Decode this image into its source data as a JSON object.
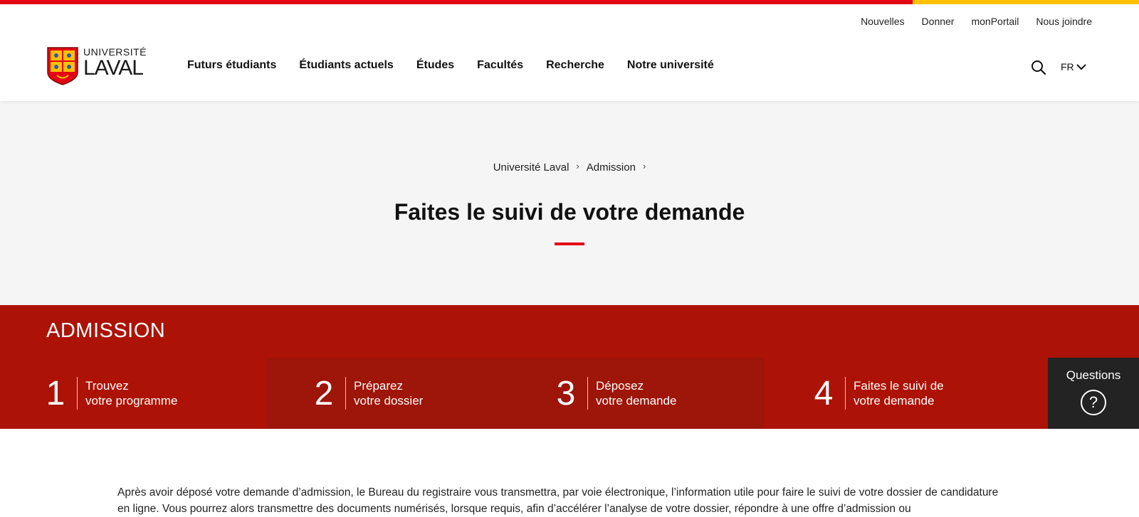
{
  "colors": {
    "brand_red": "#e30513",
    "brand_yellow": "#ffc103",
    "admission_bg": "#ac1306",
    "questions_bg": "#232323"
  },
  "utility_nav": [
    "Nouvelles",
    "Donner",
    "monPortail",
    "Nous joindre"
  ],
  "logo": {
    "line1": "UNIVERSITÉ",
    "line2": "LAVAL",
    "icon": "shield-icon"
  },
  "main_nav": [
    "Futurs étudiants",
    "Étudiants actuels",
    "Études",
    "Facultés",
    "Recherche",
    "Notre université"
  ],
  "search": {
    "icon": "search-icon"
  },
  "lang": {
    "label": "FR",
    "icon": "chevron-down-icon"
  },
  "breadcrumb": [
    "Université Laval",
    "Admission"
  ],
  "page_title": "Faites le suivi de votre demande",
  "admission": {
    "label": "ADMISSION",
    "steps": [
      {
        "number": "1",
        "line1": "Trouvez",
        "line2": "votre programme"
      },
      {
        "number": "2",
        "line1": "Préparez",
        "line2": "votre dossier"
      },
      {
        "number": "3",
        "line1": "Déposez",
        "line2": "votre demande"
      },
      {
        "number": "4",
        "line1": "Faites le suivi de",
        "line2": "votre demande"
      }
    ],
    "questions": {
      "label": "Questions",
      "icon": "question-icon",
      "symbol": "?"
    }
  },
  "intro_text": "Après avoir déposé votre demande d’admission, le Bureau du registraire vous transmettra, par voie électronique, l’information utile pour faire le suivi de votre dossier de candidature en ligne. Vous pourrez alors transmettre des documents numérisés, lorsque requis, afin d’accélérer l’analyse de votre dossier, répondre à une offre d’admission ou"
}
